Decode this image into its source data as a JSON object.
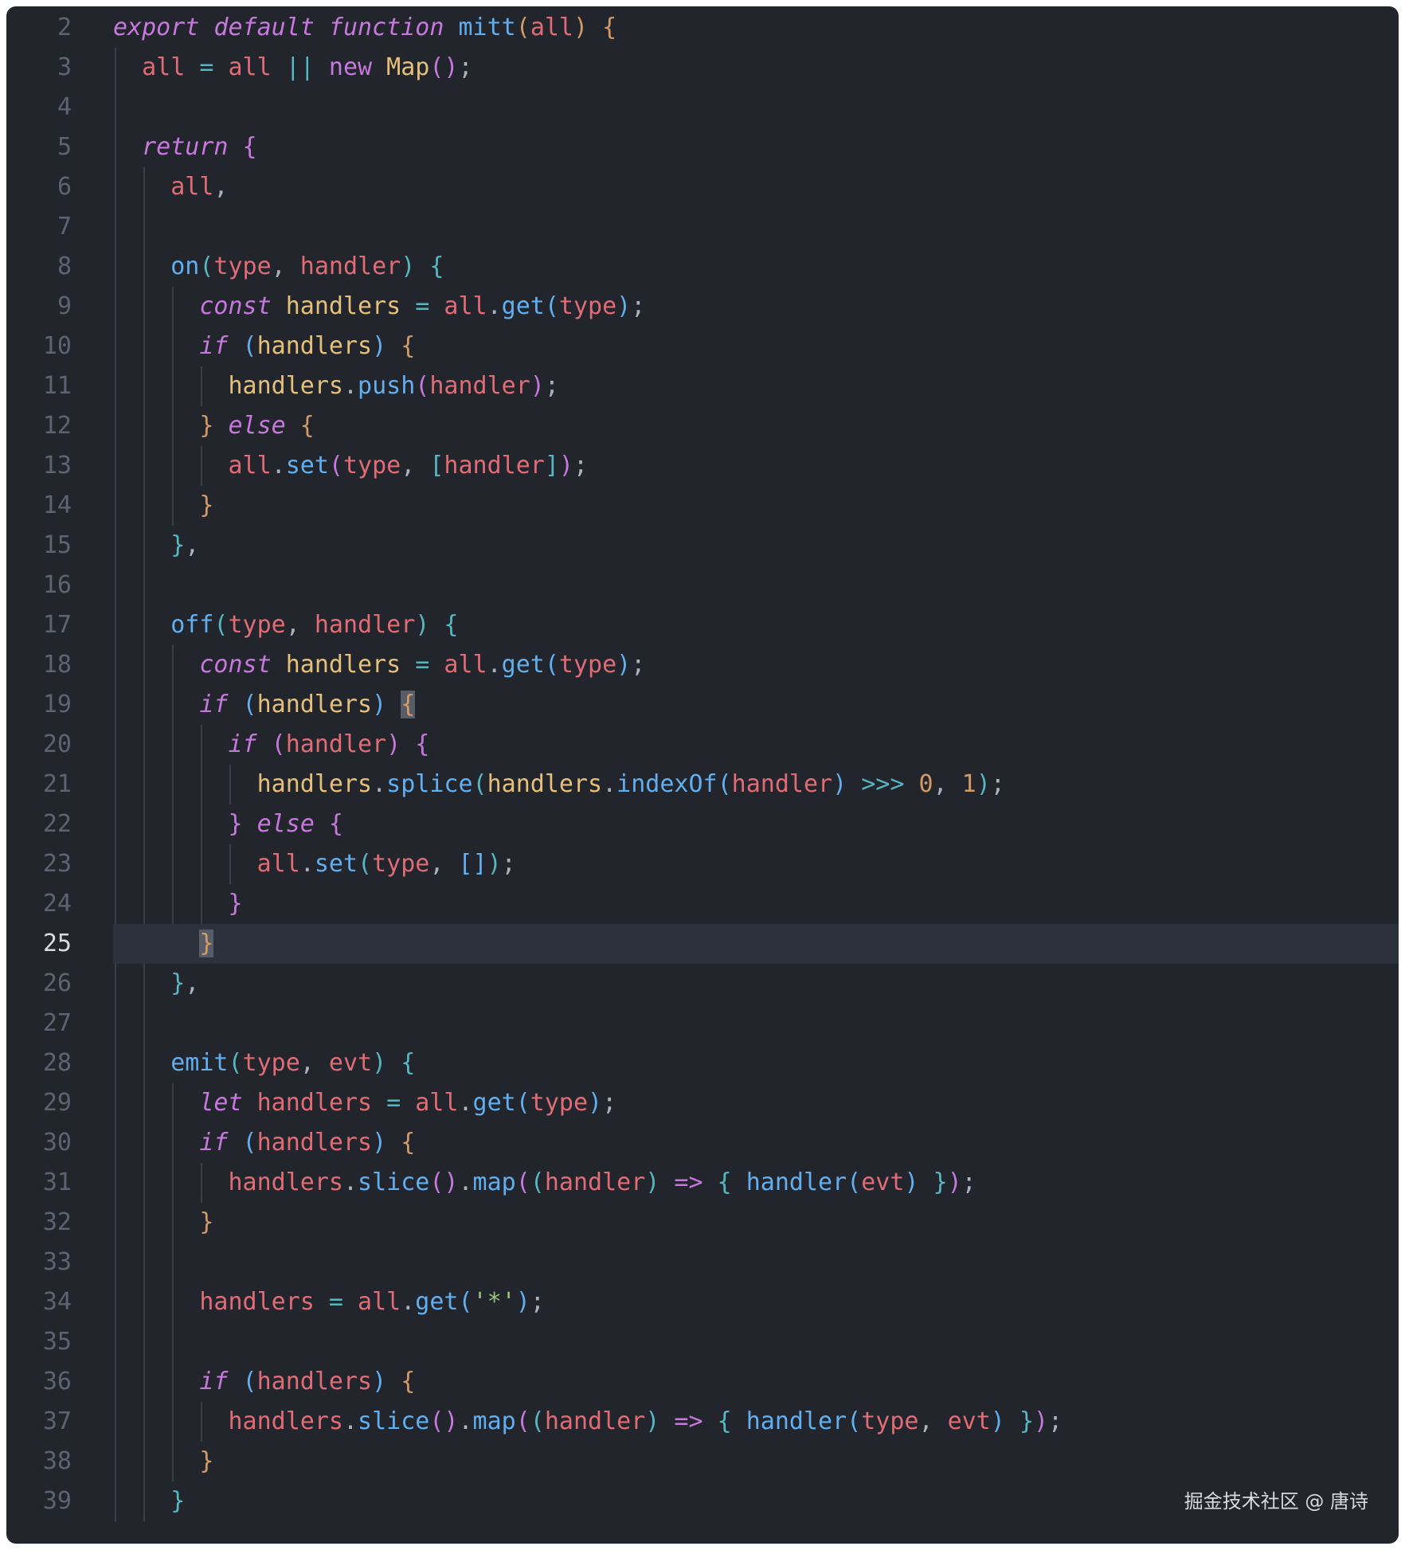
{
  "editor": {
    "active_line": 25,
    "colors": {
      "background": "#22252c",
      "line_number": "#5d6370",
      "active_line_bg": "#2d313b",
      "keyword": "#c678dd",
      "function": "#61afef",
      "identifier": "#e06c75",
      "type": "#e5c07b",
      "operator": "#56b6c2",
      "number": "#d19a66",
      "string": "#98c379"
    },
    "lines": [
      {
        "n": "2",
        "tokens": [
          [
            "export",
            "kw"
          ],
          [
            " ",
            "p"
          ],
          [
            "default",
            "kw"
          ],
          [
            " ",
            "p"
          ],
          [
            "function",
            "kw"
          ],
          [
            " ",
            "p"
          ],
          [
            "mitt",
            "fn"
          ],
          [
            "(",
            "br1"
          ],
          [
            "all",
            "id"
          ],
          [
            ")",
            "br1"
          ],
          [
            " ",
            "p"
          ],
          [
            "{",
            "br1"
          ]
        ]
      },
      {
        "n": "3",
        "tokens": [
          [
            "all",
            "id"
          ],
          [
            " ",
            "p"
          ],
          [
            "=",
            "op"
          ],
          [
            " ",
            "p"
          ],
          [
            "all",
            "id"
          ],
          [
            " ",
            "p"
          ],
          [
            "||",
            "op"
          ],
          [
            " ",
            "p"
          ],
          [
            "new",
            "kw2"
          ],
          [
            " ",
            "p"
          ],
          [
            "Map",
            "ty"
          ],
          [
            "(",
            "br2"
          ],
          [
            ")",
            "br2"
          ],
          [
            ";",
            "p"
          ]
        ]
      },
      {
        "n": "4",
        "tokens": []
      },
      {
        "n": "5",
        "tokens": [
          [
            "return",
            "kw"
          ],
          [
            " ",
            "p"
          ],
          [
            "{",
            "br2"
          ]
        ]
      },
      {
        "n": "6",
        "tokens": [
          [
            "all",
            "id"
          ],
          [
            ",",
            "p"
          ]
        ]
      },
      {
        "n": "7",
        "tokens": []
      },
      {
        "n": "8",
        "tokens": [
          [
            "on",
            "fn"
          ],
          [
            "(",
            "br3"
          ],
          [
            "type",
            "id"
          ],
          [
            ", ",
            "p"
          ],
          [
            "handler",
            "id"
          ],
          [
            ")",
            "br3"
          ],
          [
            " ",
            "p"
          ],
          [
            "{",
            "br3"
          ]
        ]
      },
      {
        "n": "9",
        "tokens": [
          [
            "const",
            "kw"
          ],
          [
            " ",
            "p"
          ],
          [
            "handlers",
            "ty"
          ],
          [
            " ",
            "p"
          ],
          [
            "=",
            "op"
          ],
          [
            " ",
            "p"
          ],
          [
            "all",
            "id"
          ],
          [
            ".",
            "p"
          ],
          [
            "get",
            "fn"
          ],
          [
            "(",
            "br4"
          ],
          [
            "type",
            "id"
          ],
          [
            ")",
            "br4"
          ],
          [
            ";",
            "p"
          ]
        ]
      },
      {
        "n": "10",
        "tokens": [
          [
            "if",
            "kw"
          ],
          [
            " ",
            "p"
          ],
          [
            "(",
            "br4"
          ],
          [
            "handlers",
            "ty"
          ],
          [
            ")",
            "br4"
          ],
          [
            " ",
            "p"
          ],
          [
            "{",
            "br1"
          ]
        ]
      },
      {
        "n": "11",
        "tokens": [
          [
            "handlers",
            "ty"
          ],
          [
            ".",
            "p"
          ],
          [
            "push",
            "fn"
          ],
          [
            "(",
            "br2"
          ],
          [
            "handler",
            "id"
          ],
          [
            ")",
            "br2"
          ],
          [
            ";",
            "p"
          ]
        ]
      },
      {
        "n": "12",
        "tokens": [
          [
            "}",
            "br1"
          ],
          [
            " ",
            "p"
          ],
          [
            "else",
            "kw"
          ],
          [
            " ",
            "p"
          ],
          [
            "{",
            "br1"
          ]
        ]
      },
      {
        "n": "13",
        "tokens": [
          [
            "all",
            "id"
          ],
          [
            ".",
            "p"
          ],
          [
            "set",
            "fn"
          ],
          [
            "(",
            "br2"
          ],
          [
            "type",
            "id"
          ],
          [
            ", ",
            "p"
          ],
          [
            "[",
            "br3"
          ],
          [
            "handler",
            "id"
          ],
          [
            "]",
            "br3"
          ],
          [
            ")",
            "br2"
          ],
          [
            ";",
            "p"
          ]
        ]
      },
      {
        "n": "14",
        "tokens": [
          [
            "}",
            "br1"
          ]
        ]
      },
      {
        "n": "15",
        "tokens": [
          [
            "}",
            "br3"
          ],
          [
            ",",
            "p"
          ]
        ]
      },
      {
        "n": "16",
        "tokens": []
      },
      {
        "n": "17",
        "tokens": [
          [
            "off",
            "fn"
          ],
          [
            "(",
            "br3"
          ],
          [
            "type",
            "id"
          ],
          [
            ", ",
            "p"
          ],
          [
            "handler",
            "id"
          ],
          [
            ")",
            "br3"
          ],
          [
            " ",
            "p"
          ],
          [
            "{",
            "br3"
          ]
        ]
      },
      {
        "n": "18",
        "tokens": [
          [
            "const",
            "kw"
          ],
          [
            " ",
            "p"
          ],
          [
            "handlers",
            "ty"
          ],
          [
            " ",
            "p"
          ],
          [
            "=",
            "op"
          ],
          [
            " ",
            "p"
          ],
          [
            "all",
            "id"
          ],
          [
            ".",
            "p"
          ],
          [
            "get",
            "fn"
          ],
          [
            "(",
            "br4"
          ],
          [
            "type",
            "id"
          ],
          [
            ")",
            "br4"
          ],
          [
            ";",
            "p"
          ]
        ]
      },
      {
        "n": "19",
        "tokens": [
          [
            "if",
            "kw"
          ],
          [
            " ",
            "p"
          ],
          [
            "(",
            "br4"
          ],
          [
            "handlers",
            "ty"
          ],
          [
            ")",
            "br4"
          ],
          [
            " ",
            "p"
          ],
          [
            "{",
            "br1m"
          ]
        ]
      },
      {
        "n": "20",
        "tokens": [
          [
            "if",
            "kw"
          ],
          [
            " ",
            "p"
          ],
          [
            "(",
            "br2"
          ],
          [
            "handler",
            "id"
          ],
          [
            ")",
            "br2"
          ],
          [
            " ",
            "p"
          ],
          [
            "{",
            "br2"
          ]
        ]
      },
      {
        "n": "21",
        "tokens": [
          [
            "handlers",
            "ty"
          ],
          [
            ".",
            "p"
          ],
          [
            "splice",
            "fn"
          ],
          [
            "(",
            "br3"
          ],
          [
            "handlers",
            "ty"
          ],
          [
            ".",
            "p"
          ],
          [
            "indexOf",
            "fn"
          ],
          [
            "(",
            "br4"
          ],
          [
            "handler",
            "id"
          ],
          [
            ")",
            "br4"
          ],
          [
            " ",
            "p"
          ],
          [
            ">>>",
            "op"
          ],
          [
            " ",
            "p"
          ],
          [
            "0",
            "num"
          ],
          [
            ", ",
            "p"
          ],
          [
            "1",
            "num"
          ],
          [
            ")",
            "br3"
          ],
          [
            ";",
            "p"
          ]
        ]
      },
      {
        "n": "22",
        "tokens": [
          [
            "}",
            "br2"
          ],
          [
            " ",
            "p"
          ],
          [
            "else",
            "kw"
          ],
          [
            " ",
            "p"
          ],
          [
            "{",
            "br2"
          ]
        ]
      },
      {
        "n": "23",
        "tokens": [
          [
            "all",
            "id"
          ],
          [
            ".",
            "p"
          ],
          [
            "set",
            "fn"
          ],
          [
            "(",
            "br3"
          ],
          [
            "type",
            "id"
          ],
          [
            ", ",
            "p"
          ],
          [
            "[",
            "br4"
          ],
          [
            "]",
            "br4"
          ],
          [
            ")",
            "br3"
          ],
          [
            ";",
            "p"
          ]
        ]
      },
      {
        "n": "24",
        "tokens": [
          [
            "}",
            "br2"
          ]
        ]
      },
      {
        "n": "25",
        "tokens": [
          [
            "}",
            "br1m"
          ]
        ]
      },
      {
        "n": "26",
        "tokens": [
          [
            "}",
            "br3"
          ],
          [
            ",",
            "p"
          ]
        ]
      },
      {
        "n": "27",
        "tokens": []
      },
      {
        "n": "28",
        "tokens": [
          [
            "emit",
            "fn"
          ],
          [
            "(",
            "br3"
          ],
          [
            "type",
            "id"
          ],
          [
            ", ",
            "p"
          ],
          [
            "evt",
            "id"
          ],
          [
            ")",
            "br3"
          ],
          [
            " ",
            "p"
          ],
          [
            "{",
            "br3"
          ]
        ]
      },
      {
        "n": "29",
        "tokens": [
          [
            "let",
            "kw"
          ],
          [
            " ",
            "p"
          ],
          [
            "handlers",
            "id"
          ],
          [
            " ",
            "p"
          ],
          [
            "=",
            "op"
          ],
          [
            " ",
            "p"
          ],
          [
            "all",
            "id"
          ],
          [
            ".",
            "p"
          ],
          [
            "get",
            "fn"
          ],
          [
            "(",
            "br4"
          ],
          [
            "type",
            "id"
          ],
          [
            ")",
            "br4"
          ],
          [
            ";",
            "p"
          ]
        ]
      },
      {
        "n": "30",
        "tokens": [
          [
            "if",
            "kw"
          ],
          [
            " ",
            "p"
          ],
          [
            "(",
            "br4"
          ],
          [
            "handlers",
            "id"
          ],
          [
            ")",
            "br4"
          ],
          [
            " ",
            "p"
          ],
          [
            "{",
            "br1"
          ]
        ]
      },
      {
        "n": "31",
        "tokens": [
          [
            "handlers",
            "id"
          ],
          [
            ".",
            "p"
          ],
          [
            "slice",
            "fn"
          ],
          [
            "(",
            "br2"
          ],
          [
            ")",
            "br2"
          ],
          [
            ".",
            "p"
          ],
          [
            "map",
            "fn"
          ],
          [
            "(",
            "br2"
          ],
          [
            "(",
            "br3"
          ],
          [
            "handler",
            "id"
          ],
          [
            ")",
            "br3"
          ],
          [
            " ",
            "p"
          ],
          [
            "=>",
            "kw2"
          ],
          [
            " ",
            "p"
          ],
          [
            "{",
            "br3"
          ],
          [
            " ",
            "p"
          ],
          [
            "handler",
            "fn"
          ],
          [
            "(",
            "br4"
          ],
          [
            "evt",
            "id"
          ],
          [
            ")",
            "br4"
          ],
          [
            " ",
            "p"
          ],
          [
            "}",
            "br3"
          ],
          [
            ")",
            "br2"
          ],
          [
            ";",
            "p"
          ]
        ]
      },
      {
        "n": "32",
        "tokens": [
          [
            "}",
            "br1"
          ]
        ]
      },
      {
        "n": "33",
        "tokens": []
      },
      {
        "n": "34",
        "tokens": [
          [
            "handlers",
            "id"
          ],
          [
            " ",
            "p"
          ],
          [
            "=",
            "op"
          ],
          [
            " ",
            "p"
          ],
          [
            "all",
            "id"
          ],
          [
            ".",
            "p"
          ],
          [
            "get",
            "fn"
          ],
          [
            "(",
            "br4"
          ],
          [
            "'*'",
            "str"
          ],
          [
            ")",
            "br4"
          ],
          [
            ";",
            "p"
          ]
        ]
      },
      {
        "n": "35",
        "tokens": []
      },
      {
        "n": "36",
        "tokens": [
          [
            "if",
            "kw"
          ],
          [
            " ",
            "p"
          ],
          [
            "(",
            "br4"
          ],
          [
            "handlers",
            "id"
          ],
          [
            ")",
            "br4"
          ],
          [
            " ",
            "p"
          ],
          [
            "{",
            "br1"
          ]
        ]
      },
      {
        "n": "37",
        "tokens": [
          [
            "handlers",
            "id"
          ],
          [
            ".",
            "p"
          ],
          [
            "slice",
            "fn"
          ],
          [
            "(",
            "br2"
          ],
          [
            ")",
            "br2"
          ],
          [
            ".",
            "p"
          ],
          [
            "map",
            "fn"
          ],
          [
            "(",
            "br2"
          ],
          [
            "(",
            "br3"
          ],
          [
            "handler",
            "id"
          ],
          [
            ")",
            "br3"
          ],
          [
            " ",
            "p"
          ],
          [
            "=>",
            "kw2"
          ],
          [
            " ",
            "p"
          ],
          [
            "{",
            "br3"
          ],
          [
            " ",
            "p"
          ],
          [
            "handler",
            "fn"
          ],
          [
            "(",
            "br4"
          ],
          [
            "type",
            "id"
          ],
          [
            ", ",
            "p"
          ],
          [
            "evt",
            "id"
          ],
          [
            ")",
            "br4"
          ],
          [
            " ",
            "p"
          ],
          [
            "}",
            "br3"
          ],
          [
            ")",
            "br2"
          ],
          [
            ";",
            "p"
          ]
        ]
      },
      {
        "n": "38",
        "tokens": [
          [
            "}",
            "br1"
          ]
        ]
      },
      {
        "n": "39",
        "tokens": [
          [
            "}",
            "br3"
          ]
        ]
      }
    ]
  },
  "watermark": "掘金技术社区 @ 唐诗"
}
